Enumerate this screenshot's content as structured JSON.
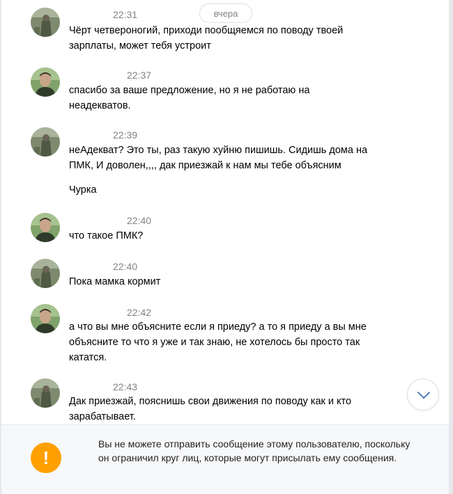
{
  "date_divider": "вчера",
  "messages": [
    {
      "time": "22:31",
      "text": "Чёрт четвероногий, приходи пообщяемся по поводу твоей\nзарплаты, может тебя устроит"
    },
    {
      "time": "22:37",
      "text": "спасибо за ваше предложение, но я не работаю на\nнеадекватов."
    },
    {
      "time": "22:39",
      "text": "неАдекват? Это ты, раз такую хуйню пишишь. Сидишь дома на\nПМК, И доволен,,,, дак приезжай к нам мы тебе объясним",
      "extra": "Чурка"
    },
    {
      "time": "22:40",
      "text": "что такое ПМК?"
    },
    {
      "time": "22:40",
      "text": "Пока мамка кормит"
    },
    {
      "time": "22:42",
      "text": "а что вы мне объясните если я приеду? а то я приеду а вы мне\nобъясните то что я уже и так знаю, не хотелось бы просто так\nкататся."
    },
    {
      "time": "22:43",
      "text": "Дак приезжай, пояснишь свои движения по поводу как и кто\nзарабатывает."
    }
  ],
  "footer": {
    "notice": "Вы не можете отправить сообщение этому пользователю, поскольку он ограничил круг лиц, которые могут присылать ему сообщения.",
    "icon": "exclamation-icon",
    "icon_symbol": "!",
    "icon_color": "#ffa000"
  },
  "colors": {
    "time": "#828282",
    "border": "#e7e8ec",
    "footer_bg": "#f7f8fa"
  }
}
